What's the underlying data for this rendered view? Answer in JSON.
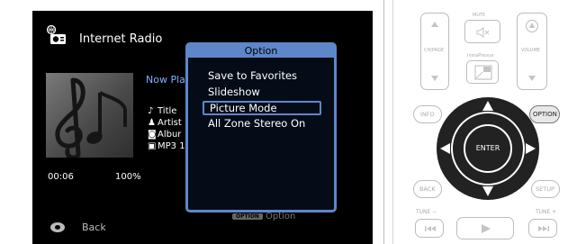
{
  "screen": {
    "source_title": "Internet Radio",
    "now_playing": "Now Pla",
    "meta": [
      {
        "glyph": "♪",
        "text": "Title"
      },
      {
        "glyph": "♟",
        "text": "Artist"
      },
      {
        "glyph": "◙",
        "text": "Albur"
      },
      {
        "glyph": "▣",
        "text": "MP3  1"
      }
    ],
    "elapsed": "00:06",
    "buffer": "100%",
    "back_label": "Back",
    "option_hint_pill": "OPTION",
    "option_hint_label": "Option"
  },
  "popup": {
    "title": "Option",
    "items": [
      "Save to Favorites",
      "Slideshow",
      "Picture Mode",
      "All Zone Stereo On"
    ],
    "selected_index": 2
  },
  "remote": {
    "mute_label": "MUTE",
    "chpage_label": "CH/PAGE",
    "insta_label": "InstaPrevue",
    "volume_label": "VOLUME",
    "info_label": "INFO",
    "option_label": "OPTION",
    "enter_label": "ENTER",
    "back_label": "BACK",
    "setup_label": "SETUP",
    "tune_minus_label": "TUNE −",
    "tune_plus_label": "TUNE +"
  },
  "colors": {
    "accent": "#5d87c9",
    "screen_bg": "#000000",
    "now_playing": "#7fb2ff"
  }
}
